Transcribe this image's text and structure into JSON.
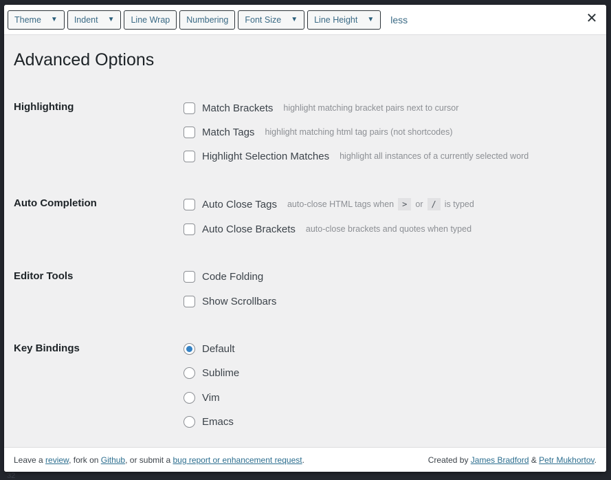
{
  "toolbar": {
    "buttons": [
      {
        "label": "Theme",
        "dropdown": true
      },
      {
        "label": "Indent",
        "dropdown": true
      },
      {
        "label": "Line Wrap",
        "dropdown": false
      },
      {
        "label": "Numbering",
        "dropdown": false
      },
      {
        "label": "Font Size",
        "dropdown": true
      },
      {
        "label": "Line Height",
        "dropdown": true
      }
    ],
    "less_link": "less",
    "close_icon": "✕"
  },
  "title": "Advanced Options",
  "sections": {
    "highlighting": {
      "label": "Highlighting",
      "options": [
        {
          "label": "Match Brackets",
          "desc": "highlight matching bracket pairs next to cursor",
          "checked": false
        },
        {
          "label": "Match Tags",
          "desc": "highlight matching html tag pairs (not shortcodes)",
          "checked": false
        },
        {
          "label": "Highlight Selection Matches",
          "desc": "highlight all instances of a currently selected word",
          "checked": false
        }
      ]
    },
    "auto_completion": {
      "label": "Auto Completion",
      "options": [
        {
          "label": "Auto Close Tags",
          "desc_prefix": "auto-close HTML tags when",
          "code1": ">",
          "desc_mid": "or",
          "code2": "/",
          "desc_suffix": "is typed",
          "checked": false
        },
        {
          "label": "Auto Close Brackets",
          "desc": "auto-close brackets and quotes when typed",
          "checked": false
        }
      ]
    },
    "editor_tools": {
      "label": "Editor Tools",
      "options": [
        {
          "label": "Code Folding",
          "checked": false
        },
        {
          "label": "Show Scrollbars",
          "checked": false
        }
      ]
    },
    "key_bindings": {
      "label": "Key Bindings",
      "selected": "Default",
      "options": [
        {
          "label": "Default"
        },
        {
          "label": "Sublime"
        },
        {
          "label": "Vim"
        },
        {
          "label": "Emacs"
        }
      ]
    }
  },
  "footer": {
    "left": {
      "t1": "Leave a ",
      "review": "review",
      "t2": ", fork on ",
      "github": "Github",
      "t3": ", or submit a ",
      "bug": "bug report or enhancement request",
      "t4": "."
    },
    "right": {
      "t1": "Created by ",
      "author1": "James Bradford",
      "t2": " & ",
      "author2": "Petr Mukhortov",
      "t3": "."
    }
  },
  "gutter_visible_number": "32",
  "colors": {
    "accent": "#3582c4",
    "link": "#2c6e8f",
    "panel_bg": "#f0f0f1",
    "backdrop": "#23262d"
  }
}
